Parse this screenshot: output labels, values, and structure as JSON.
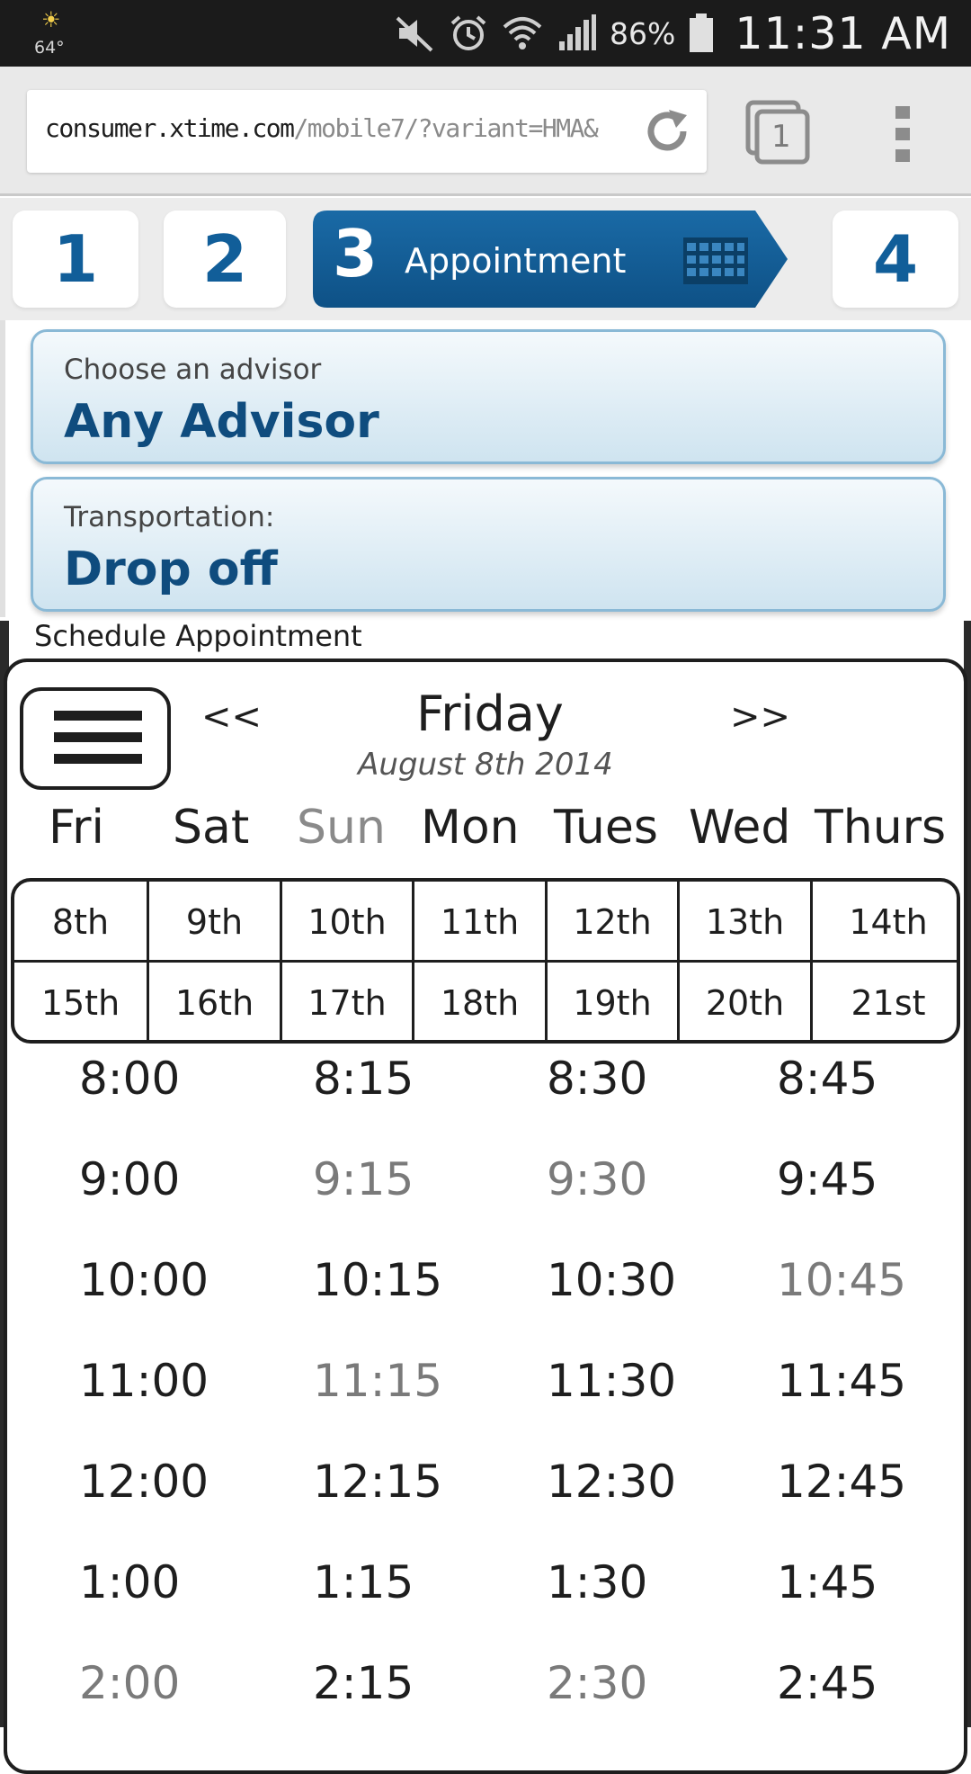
{
  "status_bar": {
    "temperature": "64°",
    "battery": "86%",
    "time": "11:31 AM",
    "icons": [
      "weather-sunny-cloud-icon",
      "mute-icon",
      "alarm-icon",
      "wifi-icon",
      "signal-icon",
      "battery-icon"
    ]
  },
  "browser": {
    "url_host": "consumer.xtime.com",
    "url_path": "/mobile7/?variant=HMA&",
    "tab_count": "1"
  },
  "steps": {
    "step1": "1",
    "step2": "2",
    "step3_num": "3",
    "step3_label": "Appointment",
    "step4": "4",
    "active_color": "#115e99"
  },
  "advisor": {
    "label": "Choose an advisor",
    "value": "Any Advisor"
  },
  "transportation": {
    "label": "Transportation:",
    "value": "Drop off"
  },
  "schedule": {
    "title": "Schedule Appointment",
    "prev": "<<",
    "next": ">>",
    "day": "Friday",
    "date": "August 8th 2014",
    "weekdays": [
      "Fri",
      "Sat",
      "Sun",
      "Mon",
      "Tues",
      "Wed",
      "Thurs"
    ],
    "weekdays_unavailable": [
      "Sun"
    ],
    "dates_row1": [
      "8th",
      "9th",
      "10th",
      "11th",
      "12th",
      "13th",
      "14th"
    ],
    "dates_row2": [
      "15th",
      "16th",
      "17th",
      "18th",
      "19th",
      "20th",
      "21st"
    ],
    "times": [
      [
        "8:00",
        "8:15",
        "8:30",
        "8:45"
      ],
      [
        "9:00",
        "9:15",
        "9:30",
        "9:45"
      ],
      [
        "10:00",
        "10:15",
        "10:30",
        "10:45"
      ],
      [
        "11:00",
        "11:15",
        "11:30",
        "11:45"
      ],
      [
        "12:00",
        "12:15",
        "12:30",
        "12:45"
      ],
      [
        "1:00",
        "1:15",
        "1:30",
        "1:45"
      ],
      [
        "2:00",
        "2:15",
        "2:30",
        "2:45"
      ]
    ],
    "times_unavailable": [
      "9:15",
      "9:30",
      "10:45",
      "11:15",
      "2:00",
      "2:30"
    ]
  }
}
